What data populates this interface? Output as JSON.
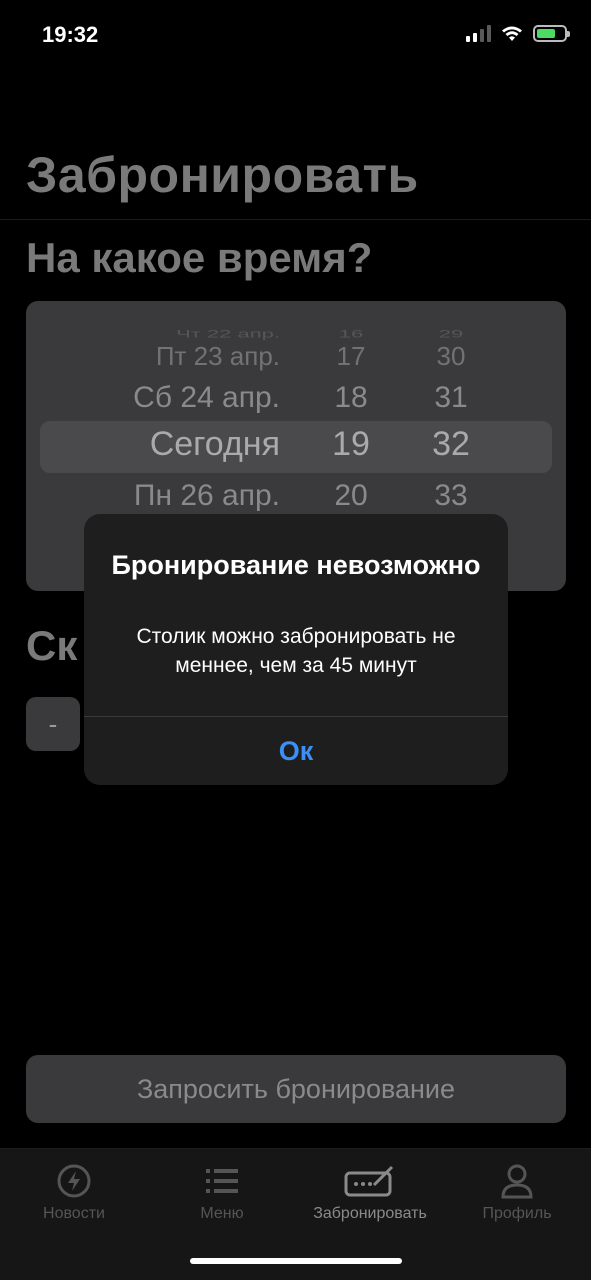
{
  "status_bar": {
    "time": "19:32"
  },
  "header": {
    "title": "Забронировать",
    "subtitle": "На какое время?"
  },
  "picker": {
    "dates": [
      "Чт 22 апр.",
      "Пт 23 апр.",
      "Сб 24 апр.",
      "Сегодня",
      "Пн 26 апр."
    ],
    "hours": [
      "16",
      "17",
      "18",
      "19",
      "20"
    ],
    "minutes": [
      "29",
      "30",
      "31",
      "32",
      "33"
    ],
    "selected": {
      "date": "Сегодня",
      "hour": "19",
      "minute": "32"
    }
  },
  "guests": {
    "label_visible": "Ск",
    "minus_label": "-"
  },
  "request_button": {
    "label": "Запросить бронирование"
  },
  "tabbar": {
    "items": [
      {
        "label": "Новости",
        "icon": "lightning-icon"
      },
      {
        "label": "Меню",
        "icon": "list-icon"
      },
      {
        "label": "Забронировать",
        "icon": "reserve-icon",
        "active": true
      },
      {
        "label": "Профиль",
        "icon": "person-icon"
      }
    ]
  },
  "alert": {
    "title": "Бронирование невозможно",
    "message": "Столик можно забронировать не меннее, чем за 45 минут",
    "ok_label": "Ок"
  },
  "colors": {
    "accent": "#3b8ff6",
    "battery": "#4cd964"
  }
}
